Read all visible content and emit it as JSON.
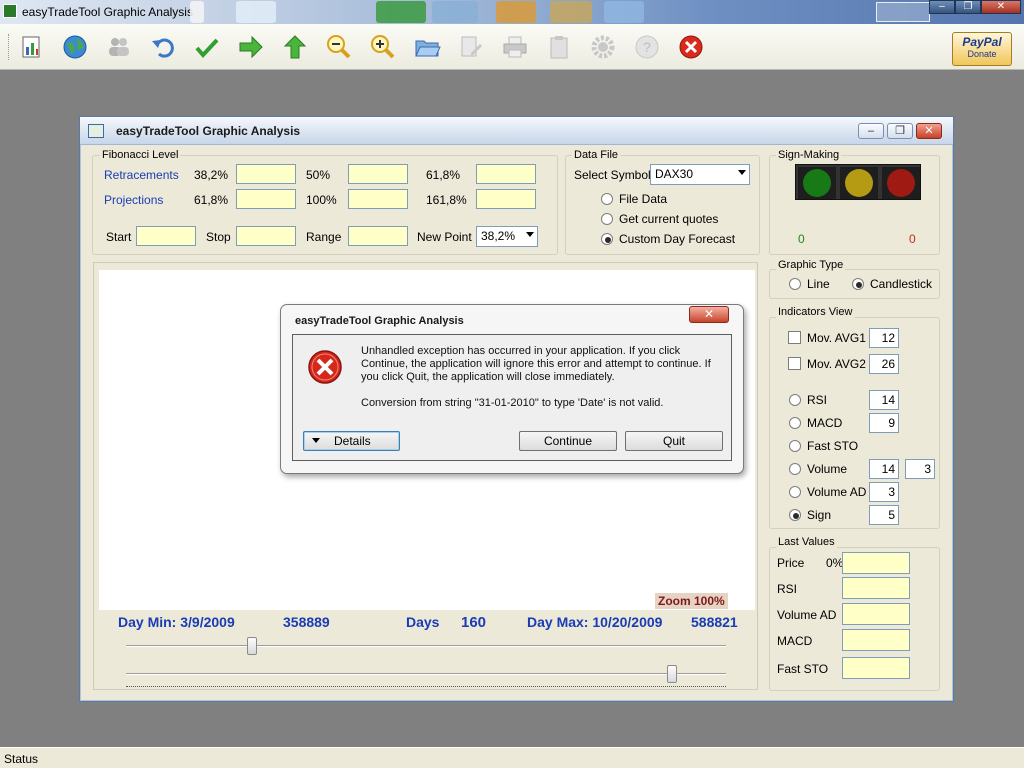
{
  "app": {
    "title": "easyTradeTool Graphic Analysis",
    "window_controls": {
      "minimize": "–",
      "restore": "❐",
      "close": "✕"
    }
  },
  "toolbar": {
    "icons": [
      "new-chart-icon",
      "globe-icon",
      "users-icon",
      "undo-icon",
      "check-icon",
      "arrow-right-icon",
      "arrow-up-icon",
      "zoom-out-icon",
      "zoom-in-icon",
      "open-folder-icon",
      "edit-icon",
      "print-icon",
      "clipboard-icon",
      "settings-icon",
      "help-icon",
      "exit-icon"
    ],
    "paypal_logo": "PayPal",
    "paypal_label": "Donate"
  },
  "child_window": {
    "title": "easyTradeTool Graphic Analysis"
  },
  "fibonacci": {
    "title": "Fibonacci Level",
    "retracements_label": "Retracements",
    "projections_label": "Projections",
    "ret_pct": [
      "38,2%",
      "50%",
      "61,8%"
    ],
    "proj_pct": [
      "61,8%",
      "100%",
      "161,8%"
    ],
    "start_label": "Start",
    "stop_label": "Stop",
    "range_label": "Range",
    "new_point_label": "New Point",
    "new_point_value": "38,2%"
  },
  "data_file": {
    "title": "Data File",
    "select_symbol_label": "Select Symbol",
    "symbol_value": "DAX30",
    "options": [
      "File Data",
      "Get current quotes",
      "Custom Day Forecast"
    ],
    "selected_option": "Custom Day Forecast"
  },
  "sign_making": {
    "title": "Sign-Making",
    "green_count": "0",
    "red_count": "0"
  },
  "graphic_type": {
    "title": "Graphic Type",
    "line_label": "Line",
    "candlestick_label": "Candlestick",
    "selected": "Candlestick"
  },
  "indicators": {
    "title": "Indicators View",
    "mov_avg1_label": "Mov. AVG1",
    "mov_avg1_value": "12",
    "mov_avg2_label": "Mov. AVG2",
    "mov_avg2_value": "26",
    "rsi_label": "RSI",
    "rsi_value": "14",
    "macd_label": "MACD",
    "macd_value": "9",
    "fast_sto_label": "Fast STO",
    "volume_label": "Volume",
    "volume_value1": "14",
    "volume_value2": "3",
    "volume_ad_label": "Volume AD",
    "volume_ad_value": "3",
    "sign_label": "Sign",
    "sign_value": "5",
    "selected": "Sign"
  },
  "last_values": {
    "title": "Last Values",
    "price_label": "Price",
    "price_pct": "0%",
    "rsi_label": "RSI",
    "volume_ad_label": "Volume AD",
    "macd_label": "MACD",
    "fast_sto_label": "Fast STO"
  },
  "chart_stats": {
    "day_min": "Day Min: 3/9/2009",
    "day_min_value": "358889",
    "days_label": "Days",
    "days_value": "160",
    "day_max": "Day Max: 10/20/2009",
    "day_max_value": "588821",
    "zoom": "Zoom 100%",
    "slider1_fraction": 0.21,
    "slider2_fraction": 0.91
  },
  "dialog": {
    "title": "easyTradeTool Graphic Analysis",
    "close": "✕",
    "message": "Unhandled exception has occurred in your application. If you click Continue, the application will ignore this error and attempt to continue. If you click Quit, the application will close immediately.",
    "detail": "Conversion from string \"31-01-2010\" to type 'Date' is not valid.",
    "details_button": "Details",
    "continue_button": "Continue",
    "quit_button": "Quit"
  },
  "statusbar": {
    "text": "Status"
  }
}
